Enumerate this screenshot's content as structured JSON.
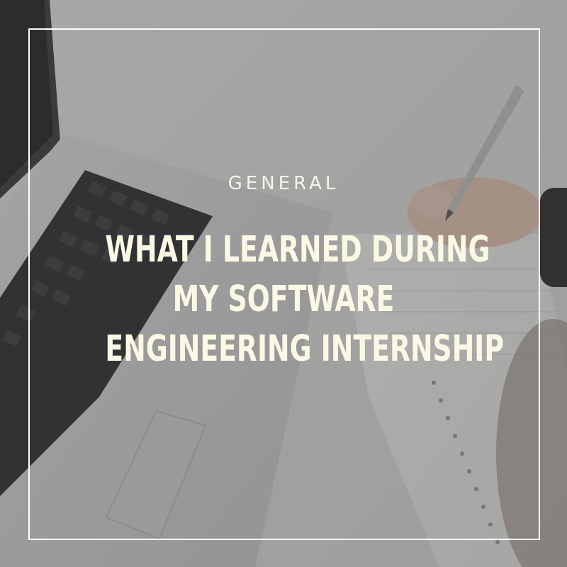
{
  "post": {
    "category": "GENERAL",
    "title_lines": [
      "WHAT I LEARNED DURING",
      "MY SOFTWARE",
      "ENGINEERING INTERNSHIP"
    ]
  },
  "colors": {
    "text": "#fbf8e6",
    "frame": "#ffffff",
    "overlay": "#3c3c3c"
  },
  "background": {
    "description_icon": "laptop-and-notebook-photo-icon"
  }
}
